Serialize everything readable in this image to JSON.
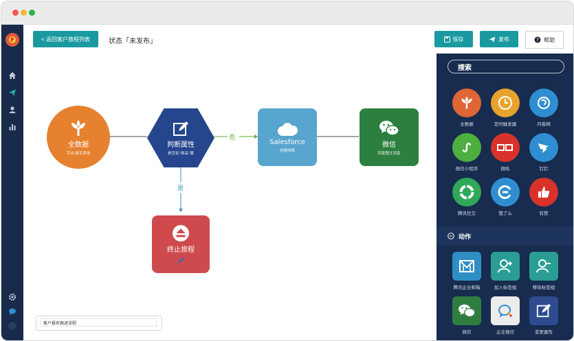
{
  "header": {
    "back_label": "< 返回客户旅程列表",
    "status": "状态「未发布」",
    "save_label": "保存",
    "publish_label": "发布",
    "help_label": "帮助"
  },
  "canvas": {
    "nodes": {
      "full_data": {
        "title": "全数据",
        "sub": "手动·报名表单"
      },
      "judge": {
        "title": "判断属性",
        "sub": "是否有\"商品\"属"
      },
      "salesforce": {
        "title": "Salesforce",
        "sub": "创建线索"
      },
      "wechat": {
        "title": "微信",
        "sub": "回复图文消息"
      },
      "stop": {
        "title": "终止旅程"
      }
    },
    "edge_no": "否",
    "edge_yes": "是",
    "flow_name": "客户报名跟进流程"
  },
  "panel": {
    "search_label": "搜索",
    "triggers": [
      {
        "label": "全数据",
        "icon": "tree-icon",
        "color": "#e06636"
      },
      {
        "label": "定时触发器",
        "icon": "clock-icon",
        "color": "#e8a32d"
      },
      {
        "label": "问卷网",
        "icon": "survey-icon",
        "color": "#2f8ed1"
      },
      {
        "label": "微信小程序",
        "icon": "miniprogram-icon",
        "color": "#4eae3f"
      },
      {
        "label": "微吼",
        "icon": "vhall-icon",
        "color": "#d9322b"
      },
      {
        "label": "钉钉",
        "icon": "dingtalk-icon",
        "color": "#2f8ed1"
      },
      {
        "label": "腾讯社交",
        "icon": "tencent-social-icon",
        "color": "#2fa85a"
      },
      {
        "label": "饿了么",
        "icon": "eleme-icon",
        "color": "#2f8ed1"
      },
      {
        "label": "有赞",
        "icon": "youzan-icon",
        "color": "#d9322b"
      }
    ],
    "actions_label": "动作",
    "actions": [
      {
        "label": "腾讯企业邮箱",
        "icon": "mail-icon",
        "color": "#2f8fc4"
      },
      {
        "label": "加入标签组",
        "icon": "add-user-icon",
        "color": "#2a9d95"
      },
      {
        "label": "移除标签组",
        "icon": "remove-user-icon",
        "color": "#2a9d95"
      },
      {
        "label": "微信",
        "icon": "wechat-icon",
        "color": "#2f7d3e"
      },
      {
        "label": "企业微信",
        "icon": "work-wechat-icon",
        "color": "#ececec"
      },
      {
        "label": "变更属性",
        "icon": "edit-icon",
        "color": "#2d4b8e"
      }
    ]
  }
}
